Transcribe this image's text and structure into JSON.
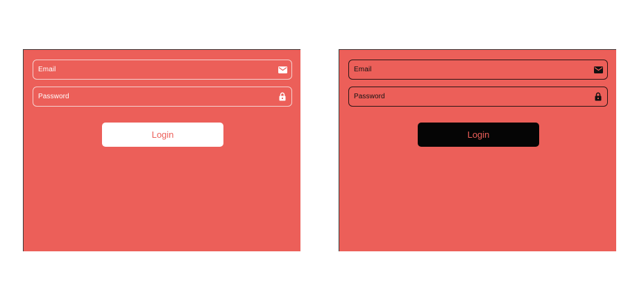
{
  "colors": {
    "panel_background": "#ec5f59",
    "light_text": "#ffffff",
    "dark_text": "#111111",
    "button_text": "#ec5f59",
    "dark_button_background": "#050505"
  },
  "light_form": {
    "email_label": "Email",
    "email_icon": "envelope-icon",
    "password_label": "Password",
    "password_icon": "lock-icon",
    "login_label": "Login"
  },
  "dark_form": {
    "email_label": "Email",
    "email_icon": "envelope-icon",
    "password_label": "Password",
    "password_icon": "lock-icon",
    "login_label": "Login"
  }
}
